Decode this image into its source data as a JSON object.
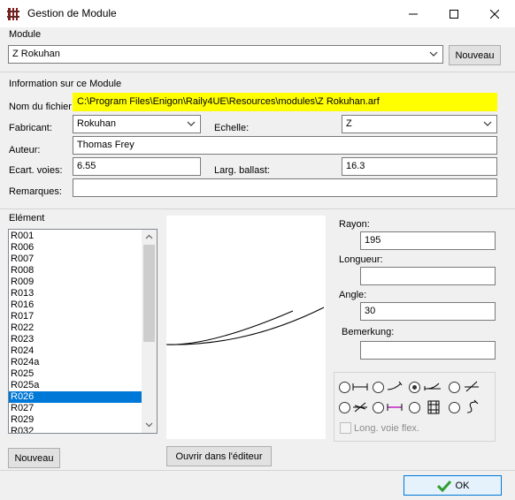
{
  "window": {
    "title": "Gestion de Module"
  },
  "module": {
    "section_label": "Module",
    "selected": "Z Rokuhan",
    "new_button": "Nouveau"
  },
  "info": {
    "section_label": "Information sur ce Module",
    "filename_label": "Nom du fichier",
    "filename_value": "C:\\Program Files\\Enigon\\Raily4UE\\Resources\\modules\\Z Rokuhan.arf",
    "manufacturer_label": "Fabricant:",
    "manufacturer_value": "Rokuhan",
    "scale_label": "Echelle:",
    "scale_value": "Z",
    "author_label": "Auteur:",
    "author_value": "Thomas Frey",
    "track_spacing_label": "Ecart. voies:",
    "track_spacing_value": "6.55",
    "ballast_width_label": "Larg. ballast:",
    "ballast_width_value": "16.3",
    "remarks_label": "Remarques:",
    "remarks_value": ""
  },
  "element": {
    "section_label": "Elément",
    "items": [
      "R001",
      "R006",
      "R007",
      "R008",
      "R009",
      "R013",
      "R016",
      "R017",
      "R022",
      "R023",
      "R024",
      "R024a",
      "R025",
      "R025a",
      "R026",
      "R027",
      "R029",
      "R032"
    ],
    "selected_index": 14,
    "new_button": "Nouveau",
    "open_editor_button": "Ouvrir dans l'éditeur"
  },
  "properties": {
    "radius_label": "Rayon:",
    "radius_value": "195",
    "length_label": "Longueur:",
    "length_value": "",
    "angle_label": "Angle:",
    "angle_value": "30",
    "note_label": "Bemerkung:",
    "note_value": "",
    "flex_track_label": "Long. voie flex."
  },
  "track_types": {
    "selected_index": 2,
    "icons": [
      "straight-track-icon",
      "curve-track-icon",
      "turnout-icon",
      "crossing-icon",
      "double-slip-icon",
      "uncoupler-track-icon",
      "bumper-icon",
      "flex-track-icon"
    ]
  },
  "footer": {
    "ok_button": "OK"
  },
  "colors": {
    "highlight": "#ffff00",
    "selection": "#0078d7",
    "ok_check": "#2e9e2e"
  }
}
